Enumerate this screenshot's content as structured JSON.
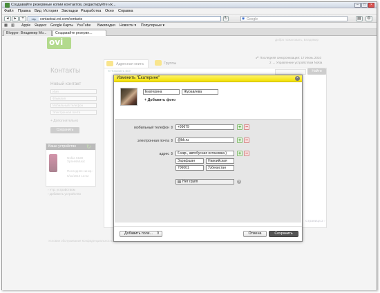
{
  "window": {
    "title": "Создавайте резервные копии контактов, редактируйте их..."
  },
  "menu": [
    "Файл",
    "Правка",
    "Вид",
    "История",
    "Закладки",
    "Разработка",
    "Окно",
    "Справка"
  ],
  "nav": {
    "url": "contactsui.ovi.com/contacts",
    "protocol_badge": "http",
    "search_placeholder": "Google"
  },
  "bookmarks": [
    "Apple",
    "Яндекс",
    "Google Карты",
    "YouTube",
    "Википедия",
    "Новости ▾",
    "Популярные ▾"
  ],
  "tabs": [
    {
      "label": "Blogger: Владимир Мо..."
    },
    {
      "label": "Создавайте резервн..."
    }
  ],
  "page": {
    "logo": "ovi",
    "welcome": "Добро пожаловать, Владимир",
    "sync_status": "Последняя синхронизация: 17 Июнь 2010",
    "manage_device": "2 → Управление устройством Nokia",
    "heading": "Контакты",
    "tab_address_book": "Адресная книга",
    "tab_groups": "Группы",
    "show_all": "◂ Показать все",
    "new_contact": {
      "title": "Новый контакт",
      "fields": [
        "Имя",
        "Фамилия",
        "Мобильный телефон",
        "Электронная почта"
      ],
      "more": "+ Дополнительно",
      "save": "Сохранить"
    },
    "device": {
      "title": "Ваше устройство",
      "name": "Nokia 5530 XpressMusic",
      "last": "Последняя синхр.:",
      "date": "6/11/2010 13:52",
      "about": "› Утр. устройством",
      "add": "› Добавить устройство"
    },
    "search_btn": "Найти",
    "pager": "Страница 2 ›",
    "footer": "Условия обслуживания  Конфиденциальность"
  },
  "modal": {
    "title": "Изменить \"Екатерине\"",
    "first_name": "Екатерина",
    "last_name": "Журавлева",
    "add_photo": "+ Добавить фото",
    "phone_label": "мобильный телефон ⇕",
    "phone_value": "+99679",
    "email_label": "электронная почта ⇕",
    "email_value": "@bk.ru",
    "address_label": "адрес ⇕",
    "address_street": "6 мкр., автобусная остановка )",
    "address_city": "Зарафшан",
    "address_region": "Навоийская",
    "address_zip": "706001",
    "address_country": "Узбекистан",
    "group": "Нет групп",
    "add_field": "Добавить поле...",
    "cancel": "Отмена",
    "save": "Сохранить"
  }
}
